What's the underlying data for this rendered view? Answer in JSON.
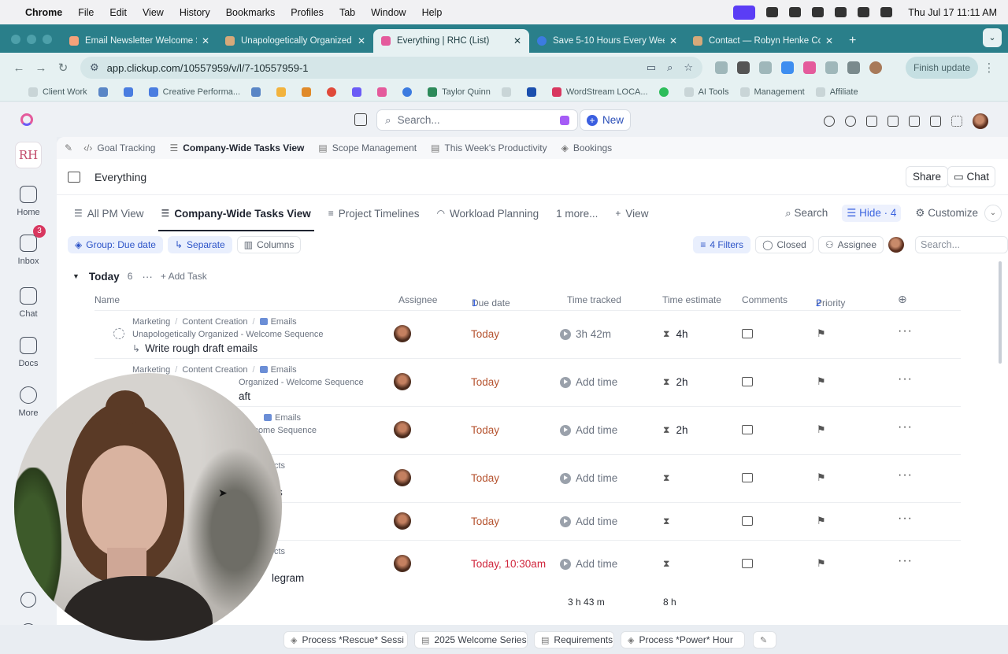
{
  "menubar": {
    "apple": "",
    "items": [
      "Chrome",
      "File",
      "Edit",
      "View",
      "History",
      "Bookmarks",
      "Profiles",
      "Tab",
      "Window",
      "Help"
    ],
    "clock": "Thu Jul 17  11:11 AM"
  },
  "tabs": [
    {
      "title": "Email Newsletter Welcome St",
      "active": false
    },
    {
      "title": "Unapologetically Organized -",
      "active": false
    },
    {
      "title": "Everything | RHC (List)",
      "active": true
    },
    {
      "title": "Save 5-10 Hours Every Week",
      "active": false
    },
    {
      "title": "Contact — Robyn Henke Con",
      "active": false
    }
  ],
  "tab_plus": "+",
  "tab_chevron": "⌄",
  "address": {
    "url": "app.clickup.com/10557959/v/l/7-10557959-1",
    "finish_label": "Finish update"
  },
  "bookmarks": [
    "Client Work",
    "Creative Performa...",
    "Taylor Quinn",
    "WordStream LOCA...",
    "AI Tools",
    "Management",
    "Affiliate"
  ],
  "topbar": {
    "search_placeholder": "Search...",
    "new_label": "New"
  },
  "rail": {
    "logo": "RH",
    "home": "Home",
    "inbox": "Inbox",
    "inbox_badge": "3",
    "chat": "Chat",
    "docs": "Docs",
    "more": "More"
  },
  "favorites": [
    "Goal Tracking",
    "Company-Wide Tasks View",
    "Scope Management",
    "This Week's Productivity",
    "Bookings"
  ],
  "header": {
    "crumb": "Everything",
    "share": "Share",
    "chat": "Chat"
  },
  "views": {
    "tabs": [
      "All PM View",
      "Company-Wide Tasks View",
      "Project Timelines",
      "Workload Planning",
      "1 more...",
      "View"
    ],
    "search": "Search",
    "hide": "Hide · 4",
    "customize": "Customize"
  },
  "toolbar": {
    "group": "Group: Due date",
    "separate": "Separate",
    "columns": "Columns",
    "filters": "4 Filters",
    "closed": "Closed",
    "assignee": "Assignee",
    "search_placeholder": "Search..."
  },
  "group": {
    "name": "Today",
    "count": "6",
    "add_task": "Add Task"
  },
  "columns": {
    "name": "Name",
    "assignee": "Assignee",
    "due": "Due date",
    "due_sort": "1",
    "tracked": "Time tracked",
    "estimate": "Time estimate",
    "comments": "Comments",
    "priority": "Priority",
    "priority_sort": "2"
  },
  "rows": [
    {
      "crumb1": "Marketing",
      "crumb2": "Content Creation",
      "crumb3": "Emails",
      "parent": "Unapologetically Organized - Welcome Sequence",
      "name": "Write rough draft emails",
      "due": "Today",
      "tracked": "3h 42m",
      "estimate": "4h"
    },
    {
      "crumb1": "Marketing",
      "crumb2": "Content Creation",
      "crumb3": "Emails",
      "parent": "Organized - Welcome Sequence",
      "name": "aft",
      "due": "Today",
      "tracked": "Add time",
      "estimate": "2h"
    },
    {
      "crumb1": "",
      "crumb2": "",
      "crumb3": "Emails",
      "parent": "lcome Sequence",
      "name": "",
      "due": "Today",
      "tracked": "Add time",
      "estimate": "2h"
    },
    {
      "crumb1": "",
      "crumb2": "",
      "crumb3": "",
      "parent": "cts",
      "name": "s",
      "due": "Today",
      "tracked": "Add time",
      "estimate": ""
    },
    {
      "crumb1": "",
      "crumb2": "",
      "crumb3": "",
      "parent": "",
      "name": "",
      "due": "Today",
      "tracked": "Add time",
      "estimate": ""
    },
    {
      "crumb1": "",
      "crumb2": "",
      "crumb3": "",
      "parent": "cts",
      "name": "legram",
      "due": "Today, 10:30am",
      "tracked": "Add time",
      "estimate": ""
    }
  ],
  "totals": {
    "tracked": "3 h 43 m",
    "estimate": "8 h"
  },
  "dock": [
    "Process *Rescue* Sessi",
    "2025 Welcome Series",
    "Requirements",
    "Process *Power* Hour"
  ]
}
